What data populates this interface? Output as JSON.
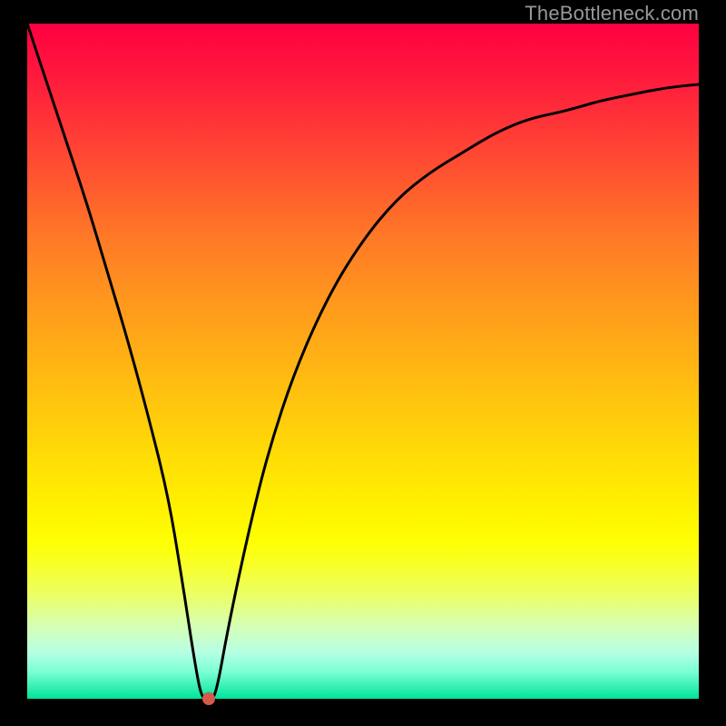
{
  "watermark": "TheBottleneck.com",
  "chart_data": {
    "type": "line",
    "title": "",
    "xlabel": "",
    "ylabel": "",
    "xlim": [
      0,
      100
    ],
    "ylim": [
      0,
      100
    ],
    "grid": false,
    "series": [
      {
        "name": "curve",
        "x": [
          0,
          3,
          6,
          9,
          12,
          15,
          18,
          21,
          23,
          25,
          26,
          27,
          28,
          30,
          33,
          36,
          40,
          45,
          50,
          55,
          60,
          65,
          70,
          75,
          80,
          85,
          90,
          95,
          100
        ],
        "y": [
          100,
          91,
          82,
          73,
          63,
          53,
          42,
          30,
          18,
          5,
          0,
          0,
          0,
          11,
          25,
          37,
          49,
          60,
          68,
          74,
          78,
          81,
          84,
          86,
          87,
          88.5,
          89.5,
          90.5,
          91
        ]
      }
    ],
    "marker": {
      "x": 27,
      "y": 0,
      "color": "#d65a4a"
    },
    "background_gradient": {
      "top": "#ff0040",
      "mid": "#ffe000",
      "bottom": "#00e39a"
    }
  }
}
